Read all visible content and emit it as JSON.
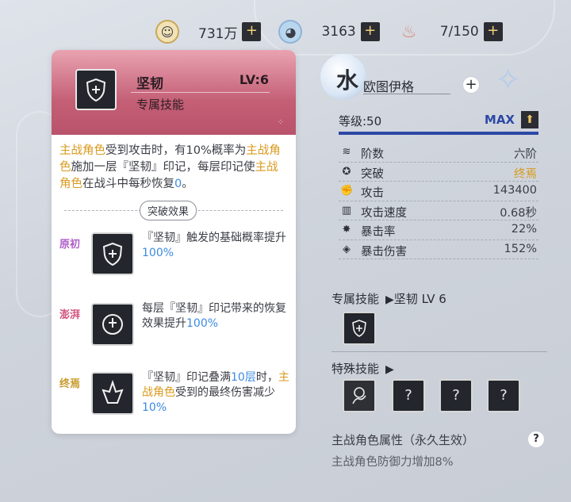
{
  "resources": [
    {
      "icon": "gold-coin-icon",
      "value": "731万"
    },
    {
      "icon": "slime-crystal-icon",
      "value": "3163"
    },
    {
      "icon": "drumstick-icon",
      "value": "7/150"
    }
  ],
  "skill_card": {
    "name": "坚韧",
    "level": "LV:6",
    "type": "专属技能",
    "desc_parts": [
      {
        "t": "主战角色",
        "c": "gold"
      },
      {
        "t": "受到攻击时，有10%概率为",
        "c": ""
      },
      {
        "t": "主战角色",
        "c": "gold"
      },
      {
        "t": "施加一层『坚韧』印记，每层印记使",
        "c": ""
      },
      {
        "t": "主战角色",
        "c": "gold"
      },
      {
        "t": "在战斗中每秒恢复",
        "c": ""
      },
      {
        "t": "0",
        "c": "blue"
      },
      {
        "t": "。",
        "c": ""
      }
    ],
    "breakthrough_title": "突破效果",
    "breakthroughs": [
      {
        "label": "原初",
        "label_color": "#b05fc7",
        "parts": [
          {
            "t": "『坚韧』触发的基础概率提升",
            "c": ""
          },
          {
            "t": "100%",
            "c": "blue"
          }
        ]
      },
      {
        "label": "澎湃",
        "label_color": "#d0567e",
        "parts": [
          {
            "t": "每层『坚韧』印记带来的恢复效果提升",
            "c": ""
          },
          {
            "t": "100%",
            "c": "blue"
          }
        ]
      },
      {
        "label": "终焉",
        "label_color": "#c79a2a",
        "parts": [
          {
            "t": "『坚韧』印记叠满",
            "c": ""
          },
          {
            "t": "10层",
            "c": "blue"
          },
          {
            "t": "时，",
            "c": ""
          },
          {
            "t": "主战角色",
            "c": "gold"
          },
          {
            "t": "受到的最终伤害减少",
            "c": ""
          },
          {
            "t": "10%",
            "c": "blue"
          }
        ]
      }
    ]
  },
  "hero": {
    "element": "水",
    "name": "欧图伊格",
    "level_label": "等级:50",
    "max_label": "MAX",
    "level_progress": 1.0
  },
  "stats": [
    {
      "icon": "layers-icon",
      "name": "阶数",
      "value": "六阶",
      "color": "#3b3d44"
    },
    {
      "icon": "breakthrough-icon",
      "name": "突破",
      "value": "终焉",
      "color": "#d99a1c"
    },
    {
      "icon": "fist-icon",
      "name": "攻击",
      "value": "143400",
      "color": "#3b3d44"
    },
    {
      "icon": "bar-icon",
      "name": "攻击速度",
      "value": "0.68秒",
      "color": "#3b3d44"
    },
    {
      "icon": "crit-icon",
      "name": "暴击率",
      "value": "22%",
      "color": "#3b3d44"
    },
    {
      "icon": "crit-damage-icon",
      "name": "暴击伤害",
      "value": "152%",
      "color": "#3b3d44"
    }
  ],
  "exclusive_skill": {
    "title": "专属技能",
    "arrow": "▶",
    "value": "坚韧 LV 6"
  },
  "special_skill": {
    "title": "特殊技能",
    "arrow": "▶",
    "unknown": [
      "?",
      "?",
      "?"
    ]
  },
  "main_attr": {
    "title": "主战角色属性（永久生效）",
    "help": "?",
    "desc": "主战角色防御力增加8%"
  }
}
